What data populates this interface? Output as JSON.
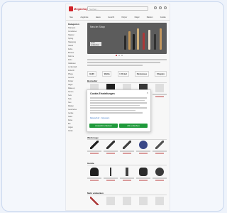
{
  "header": {
    "brand": "Megashop",
    "search_placeholder": "Suchen..."
  },
  "nav": {
    "items": [
      "Neu",
      "Angebote",
      "Haare",
      "Gesicht",
      "Körper",
      "Nägel",
      "Marken",
      "Geräte"
    ]
  },
  "sidebar": {
    "title": "Kategorien",
    "items": [
      "Shampoo",
      "Conditioner",
      "Haarkur",
      "Styling",
      "Haarspray",
      "Haaröl",
      "Farbe",
      "Bürsten",
      "Kämme",
      "Föhn",
      "Glätteisen",
      "Lockenstab",
      "Zubehör",
      "Pflege",
      "Gesicht",
      "Körper",
      "Nägel",
      "Make-up",
      "Herren",
      "Sets",
      "Sale",
      "Neu",
      "Marken",
      "Geschenke",
      "Geräte",
      "Salon",
      "Reise",
      "Bio",
      "Vegan",
      "Outlet"
    ]
  },
  "banner": {
    "heading": "Neu im Shop",
    "caption": "Jetzt entdecken"
  },
  "brands": [
    "GHD",
    "Wella",
    "L'Oréal",
    "Kérastase",
    "Olaplex"
  ],
  "sections": {
    "bestseller": "Bestseller",
    "tools": "Werkzeuge",
    "devices": "Geräte",
    "more": "Mehr entdecken"
  },
  "cookie": {
    "title": "Cookie-Einstellungen",
    "links": "Datenschutz · Impressum",
    "accept_selected": "Auswahl erlauben",
    "accept_all": "Alle erlauben"
  },
  "footer_marker": "—"
}
